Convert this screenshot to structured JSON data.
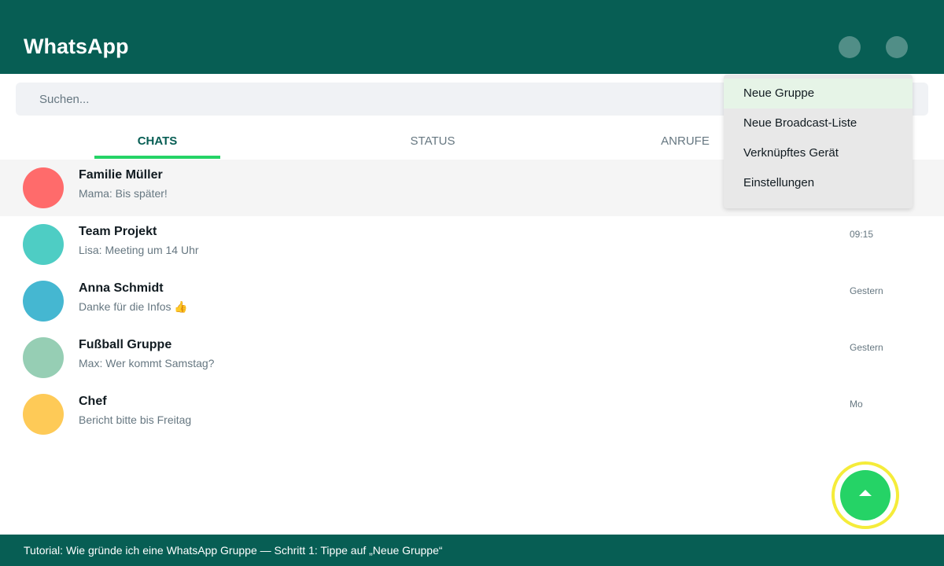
{
  "header": {
    "title": "WhatsApp",
    "search_icon": "search-icon",
    "menu_icon": "more-options-icon"
  },
  "search": {
    "placeholder": "Suchen..."
  },
  "tabs": [
    {
      "label": "CHATS",
      "active": true
    },
    {
      "label": "STATUS",
      "active": false
    },
    {
      "label": "ANRUFE",
      "active": false
    }
  ],
  "chats": [
    {
      "name": "Familie Müller",
      "preview": "Mama: Bis später!",
      "time": "",
      "avatar_color": "#ff6b6b",
      "selected": true
    },
    {
      "name": "Team Projekt",
      "preview": "Lisa: Meeting um 14 Uhr",
      "time": "09:15",
      "avatar_color": "#4ecdc4",
      "selected": false
    },
    {
      "name": "Anna Schmidt",
      "preview": "Danke für die Infos 👍",
      "time": "Gestern",
      "avatar_color": "#45b7d1",
      "selected": false
    },
    {
      "name": "Fußball Gruppe",
      "preview": "Max: Wer kommt Samstag?",
      "time": "Gestern",
      "avatar_color": "#96ceb4",
      "selected": false
    },
    {
      "name": "Chef",
      "preview": "Bericht bitte bis Freitag",
      "time": "Mo",
      "avatar_color": "#feca57",
      "selected": false
    }
  ],
  "menu": {
    "items": [
      {
        "label": "Neue Gruppe",
        "highlighted": true
      },
      {
        "label": "Neue Broadcast-Liste",
        "highlighted": false
      },
      {
        "label": "Verknüpftes Gerät",
        "highlighted": false
      },
      {
        "label": "Einstellungen",
        "highlighted": false
      }
    ]
  },
  "fab": {
    "icon": "scroll-up-arrow-icon"
  },
  "footer": {
    "text": "Tutorial: Wie gründe ich eine WhatsApp Gruppe — Schritt 1: Tippe auf „Neue Gruppe“"
  },
  "colors": {
    "brand": "#075e54",
    "accent": "#25d366",
    "highlight_ring": "#f5ec3a"
  }
}
